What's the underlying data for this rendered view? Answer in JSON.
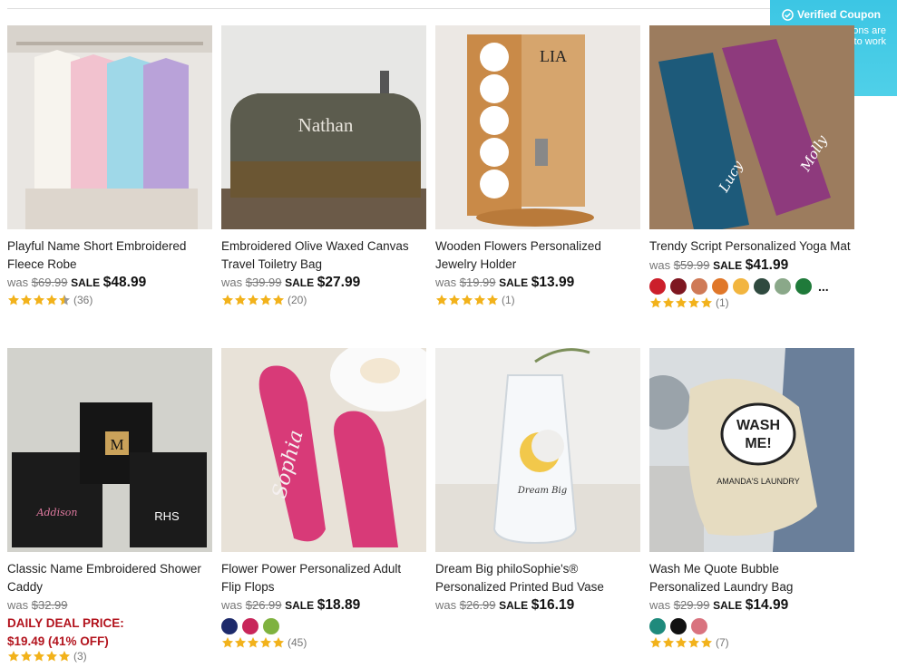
{
  "coupon": {
    "title": "Verified Coupon",
    "line1": "Our coupons are",
    "line2": "guaranteed to work",
    "icon": "check-circle-icon"
  },
  "products": [
    {
      "title_l1": "Playful Name Short Embroidered",
      "title_l2": "Fleece Robe",
      "was_label": "was",
      "was": "$69.99",
      "sale_label": "SALE",
      "sale": "$48.99",
      "rating": 4.5,
      "reviews": "(36)",
      "image": "white pink blue purple robes on hangers"
    },
    {
      "title_l1": "Embroidered Olive Waxed Canvas",
      "title_l2": "Travel Toiletry Bag",
      "was_label": "was",
      "was": "$39.99",
      "sale_label": "SALE",
      "sale": "$27.99",
      "rating": 5,
      "reviews": "(20)",
      "image_text": "Nathan"
    },
    {
      "title_l1": "Wooden Flowers Personalized",
      "title_l2": "Jewelry Holder",
      "was_label": "was",
      "was": "$19.99",
      "sale_label": "SALE",
      "sale": "$13.99",
      "rating": 5,
      "reviews": "(1)",
      "image_text": "LIA"
    },
    {
      "title_l1": "Trendy Script Personalized Yoga Mat",
      "title_l2": "",
      "was_label": "was",
      "was": "$59.99",
      "sale_label": "SALE",
      "sale": "$41.99",
      "rating": 5,
      "reviews": "(1)",
      "more": "...",
      "swatches": [
        "#cc1f2b",
        "#7e1721",
        "#cf7a57",
        "#e07729",
        "#f2b53f",
        "#2f4a3f",
        "#8aa889",
        "#1f7a3a"
      ],
      "image_text_1": "Lucy",
      "image_text_2": "Molly"
    },
    {
      "title_l1": "Classic Name Embroidered Shower",
      "title_l2": "Caddy",
      "was_label": "was",
      "was": "$32.99",
      "deal_label": "DAILY DEAL PRICE:",
      "deal_price": "$19.49 (41% OFF)",
      "rating": 5,
      "reviews": "(3)",
      "image_text_1": "M",
      "image_text_2": "RHS",
      "image_text_3": "Addison"
    },
    {
      "title_l1": "Flower Power Personalized Adult",
      "title_l2": "Flip Flops",
      "was_label": "was",
      "was": "$26.99",
      "sale_label": "SALE",
      "sale": "$18.89",
      "rating": 5,
      "reviews": "(45)",
      "swatches": [
        "#1d2a6b",
        "#c8265a",
        "#7fb23f"
      ],
      "image_text": "Sophia"
    },
    {
      "title_l1": "Dream Big philoSophie's®",
      "title_l2": "Personalized Printed Bud Vase",
      "was_label": "was",
      "was": "$26.99",
      "sale_label": "SALE",
      "sale": "$16.19",
      "image_text": "Dream Big"
    },
    {
      "title_l1": "Wash Me Quote Bubble",
      "title_l2": "Personalized Laundry Bag",
      "was_label": "was",
      "was": "$29.99",
      "sale_label": "SALE",
      "sale": "$14.99",
      "rating": 5,
      "reviews": "(7)",
      "swatches": [
        "#1f8a7c",
        "#111111",
        "#d9737f"
      ],
      "image_text_1": "WASH",
      "image_text_2": "ME!",
      "image_text_3": "AMANDA'S LAUNDRY"
    }
  ],
  "colors": {
    "star": "#f2b21b",
    "price": "#111111",
    "deal": "#b3141e",
    "coupon": "#3cc6e4"
  }
}
